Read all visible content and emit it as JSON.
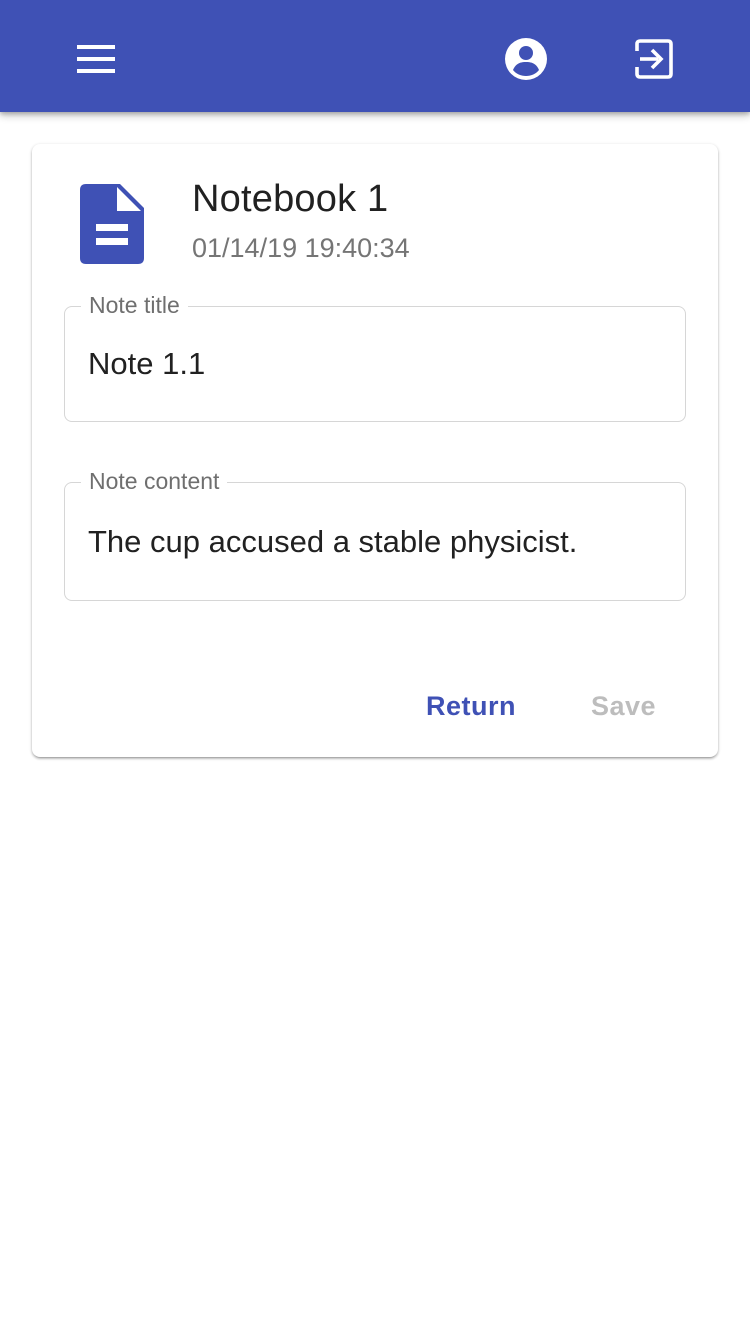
{
  "appbar": {
    "color": "#3f51b5",
    "icons": {
      "menu": "menu-icon",
      "account": "account-circle-icon",
      "logout": "exit-to-app-icon"
    }
  },
  "note": {
    "notebook_title": "Notebook 1",
    "timestamp": "01/14/19 19:40:34",
    "icon": "document-icon",
    "title_field": {
      "label": "Note title",
      "value": "Note 1.1"
    },
    "content_field": {
      "label": "Note content",
      "value": "The cup accused a stable physicist."
    }
  },
  "actions": {
    "return_label": "Return",
    "save_label": "Save",
    "save_disabled": true
  }
}
